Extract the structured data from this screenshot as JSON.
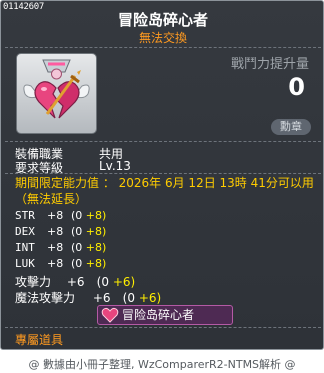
{
  "item": {
    "code": "01142607",
    "name": "冒险岛碎心者",
    "tradeability": "無法交換",
    "power_label": "戰鬥力提升量",
    "power_value": "0",
    "medal_button": "勳章",
    "job_label": "裝備職業",
    "job_value": "共用",
    "level_label": "要求等級",
    "level_value": "Lv.13",
    "period_text": "期間限定能力值 ： 2026年 6月 12日 13時 41分可以用（無法延長）",
    "stats": [
      {
        "key": "STR",
        "value": "+8",
        "base": "(0",
        "bonus": "+8)"
      },
      {
        "key": "DEX",
        "value": "+8",
        "base": "(0",
        "bonus": "+8)"
      },
      {
        "key": "INT",
        "value": "+8",
        "base": "(0",
        "bonus": "+8)"
      },
      {
        "key": "LUK",
        "value": "+8",
        "base": "(0",
        "bonus": "+8)"
      }
    ],
    "attack_label": "攻擊力",
    "attack_value": "+6",
    "attack_base": "(0",
    "attack_bonus": "+6)",
    "magic_label": "魔法攻擊力",
    "magic_value": "+6",
    "magic_base": "(0",
    "magic_bonus": "+6)",
    "set_name": "冒险岛碎心者",
    "exclusive": "專屬道具"
  },
  "footer": "@ 數據由小冊子整理, WzComparerR2-NTMS解析 @",
  "icons": {
    "item_icon": "broken-heart-medal-icon",
    "set_icon": "heart-icon"
  },
  "colors": {
    "background": "#2e3238",
    "title": "#ffffff",
    "untradeable": "#ff9a20",
    "period": "#ffcc00",
    "bonus": "#ffee00",
    "set_bg": "#4e2a53"
  }
}
